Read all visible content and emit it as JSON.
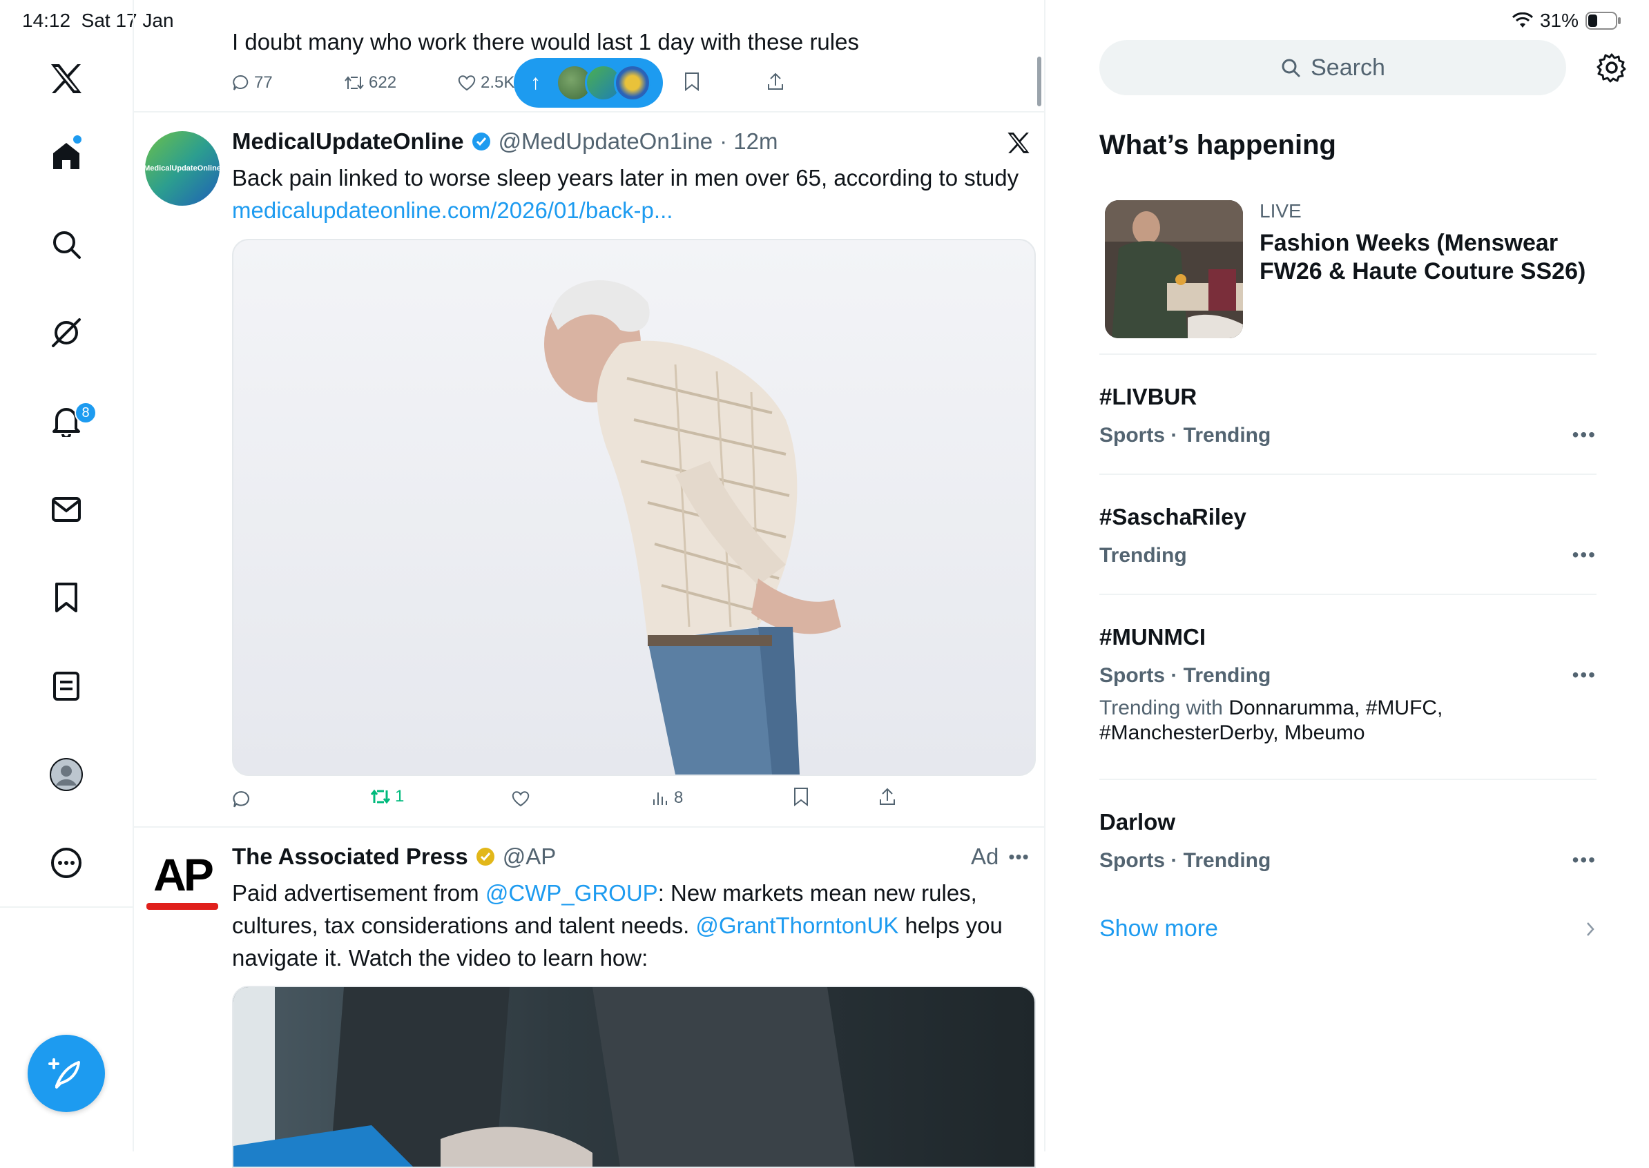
{
  "status_bar": {
    "time": "14:12",
    "date": "Sat 17 Jan",
    "battery": "31%"
  },
  "nav": {
    "notifications_badge": "8",
    "items": [
      "x-logo",
      "home",
      "explore",
      "grok",
      "notifications",
      "messages",
      "bookmarks",
      "lists",
      "profile",
      "more"
    ]
  },
  "feed": {
    "prev_tweet": {
      "text": "I doubt many who work there would last 1 day with these rules",
      "replies": "77",
      "reposts": "622",
      "likes": "2.5K"
    },
    "new_posts_pill": {
      "label": "↑"
    },
    "tweet1": {
      "avatar_text": "MedicalUpdateOnline",
      "name": "MedicalUpdateOnline",
      "handle": "@MedUpdateOn1ine",
      "time": "· 12m",
      "text": "Back pain linked to worse sleep years later in men over 65, according to study ",
      "link": "medicalupdateonline.com/2026/01/back-p...",
      "reposts": "1",
      "views": "8"
    },
    "tweet2": {
      "avatar_text": "AP",
      "name": "The Associated Press",
      "handle": "@AP",
      "ad_label": "Ad",
      "text_part1": "Paid advertisement from ",
      "mention1": "@CWP_GROUP",
      "text_part2": ": New markets mean new rules, cultures, tax considerations and talent needs. ",
      "mention2": "@GrantThorntonUK",
      "text_part3": " helps you navigate it. Watch the video to learn how:"
    }
  },
  "sidebar": {
    "search_placeholder": "Search",
    "whats_happening": "What’s happening",
    "live": {
      "label": "LIVE",
      "title": "Fashion Weeks (Menswear FW26 & Haute Couture SS26)"
    },
    "trends": [
      {
        "name": "#LIVBUR",
        "meta": "Sports · Trending"
      },
      {
        "name": "#SaschaRiley",
        "meta": "Trending"
      },
      {
        "name": "#MUNMCI",
        "meta": "Sports · Trending",
        "with_label": "Trending with ",
        "with": "Donnarumma, #MUFC, #ManchesterDerby, Mbeumo"
      },
      {
        "name": "Darlow",
        "meta": "Sports · Trending"
      }
    ],
    "show_more": "Show more"
  },
  "colors": {
    "accent": "#1d9bf0",
    "repost_green": "#00ba7c",
    "text": "#0f1419",
    "muted": "#536471",
    "ap_red": "#e0201c"
  }
}
